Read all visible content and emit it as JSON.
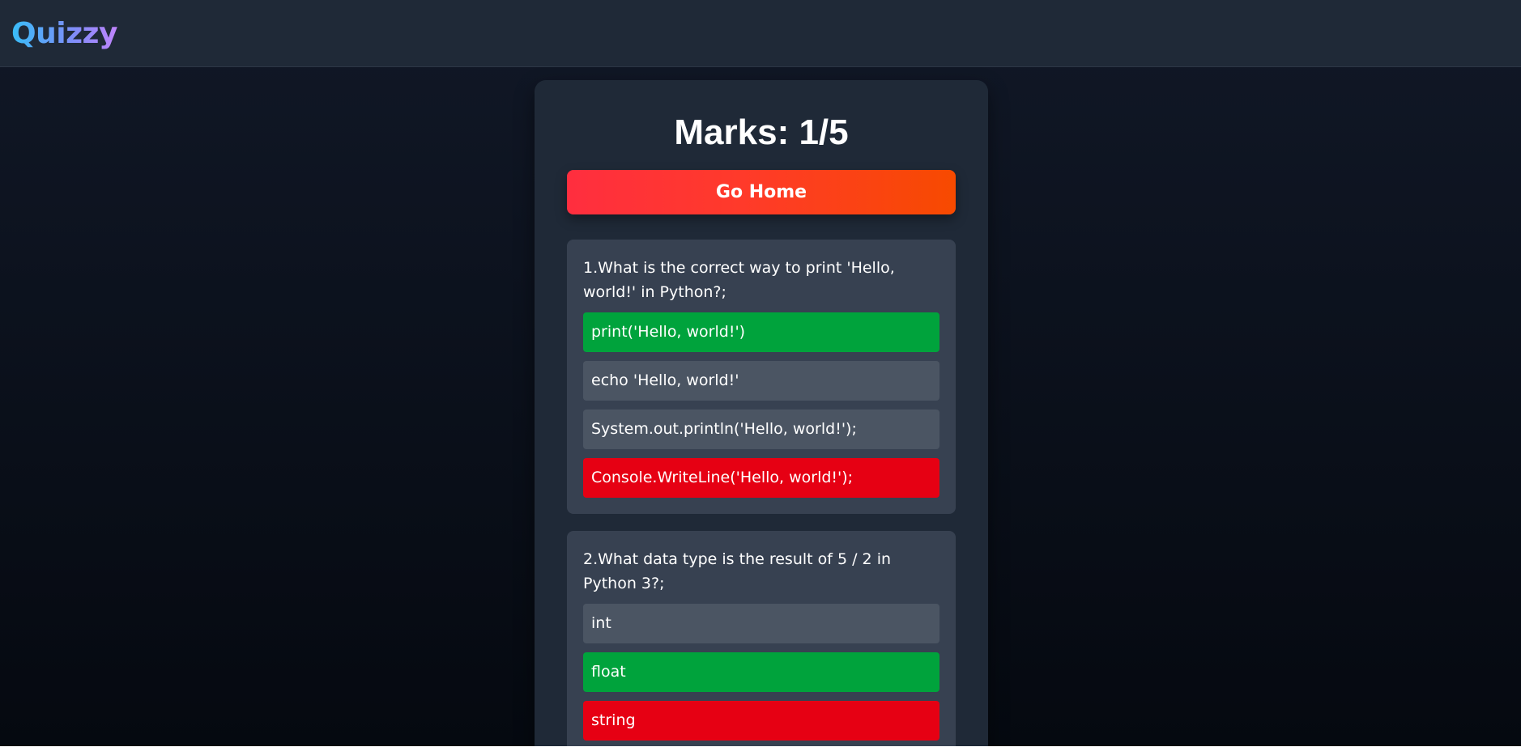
{
  "app": {
    "brand": "Quizzy"
  },
  "result": {
    "marks_label": "Marks: 1/5",
    "home_button": "Go Home"
  },
  "questions": [
    {
      "text": "1.What is the correct way to print 'Hello, world!' in Python?;",
      "options": [
        {
          "label": "print('Hello, world!')",
          "state": "correct"
        },
        {
          "label": "echo 'Hello, world!'",
          "state": "neutral"
        },
        {
          "label": "System.out.println('Hello, world!');",
          "state": "neutral"
        },
        {
          "label": "Console.WriteLine('Hello, world!');",
          "state": "wrong"
        }
      ]
    },
    {
      "text": "2.What data type is the result of 5 / 2 in Python 3?;",
      "options": [
        {
          "label": "int",
          "state": "neutral"
        },
        {
          "label": "float",
          "state": "correct"
        },
        {
          "label": "string",
          "state": "wrong"
        }
      ]
    }
  ],
  "colors": {
    "correct": "#00a33c",
    "wrong": "#e60013",
    "neutral": "#4b5563",
    "card": "#1f2937",
    "question_card": "#374151"
  }
}
